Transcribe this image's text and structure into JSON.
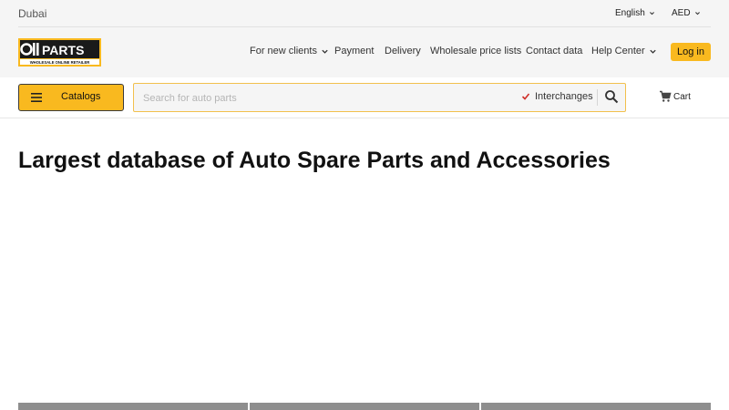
{
  "header": {
    "city": "Dubai",
    "language": "English",
    "currency": "AED",
    "login_label": "Log in",
    "logo_text": "PARTS",
    "logo_sub": "WHOLESALE ONLINE RETAILER"
  },
  "nav": [
    {
      "label": "For new clients",
      "has_dropdown": true
    },
    {
      "label": "Payment"
    },
    {
      "label": "Delivery"
    },
    {
      "label": "Wholesale price lists"
    },
    {
      "label": "Contact data"
    },
    {
      "label": "Help Center",
      "has_dropdown": true
    }
  ],
  "search": {
    "catalogs_label": "Catalogs",
    "placeholder": "Search for auto parts",
    "value": "",
    "interchanges_label": "Interchanges",
    "interchanges_checked": true
  },
  "cart": {
    "label": "Cart"
  },
  "main": {
    "title": "Largest database of Auto Spare Parts and Accessories"
  },
  "colors": {
    "accent": "#f9b91f",
    "topbar": "#f5f5f5",
    "check": "#d0302a"
  },
  "icons": [
    "chevron-down-icon",
    "menu-icon",
    "checkmark-icon",
    "search-icon",
    "cart-icon"
  ]
}
